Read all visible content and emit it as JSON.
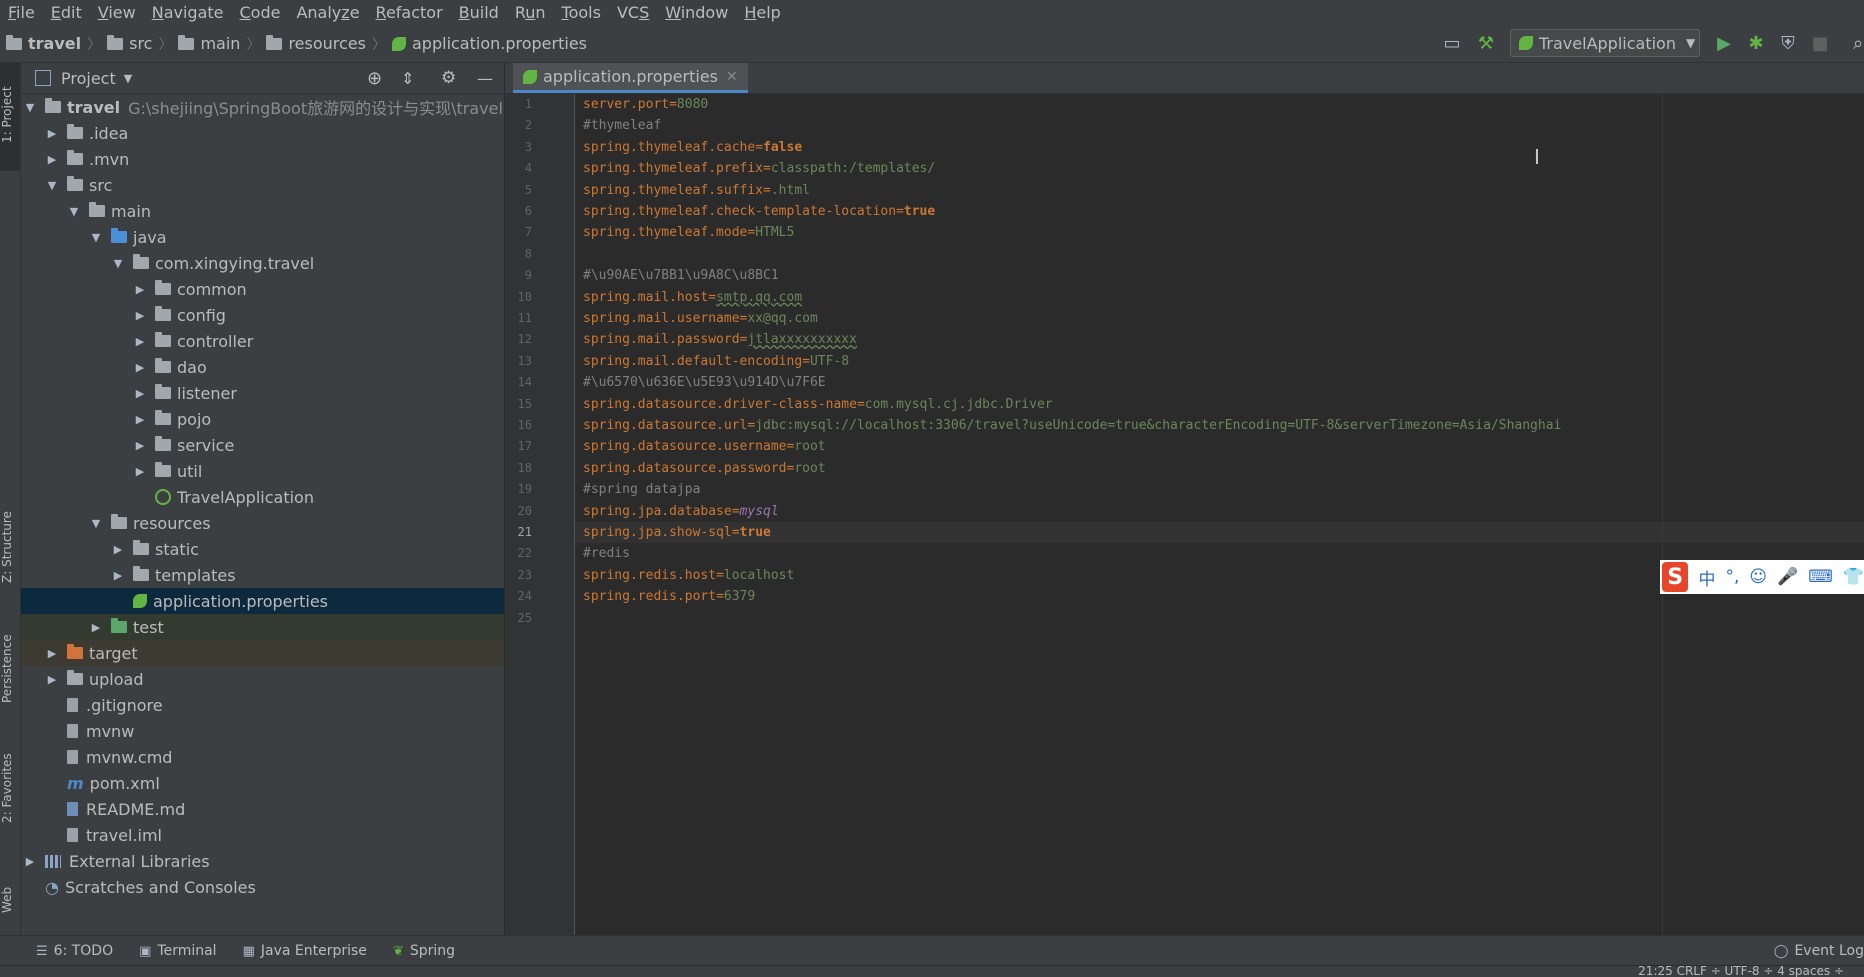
{
  "menu": [
    {
      "label": "File",
      "mn": "F"
    },
    {
      "label": "Edit",
      "mn": "E"
    },
    {
      "label": "View",
      "mn": "V"
    },
    {
      "label": "Navigate",
      "mn": "N"
    },
    {
      "label": "Code",
      "mn": "C"
    },
    {
      "label": "Analyze",
      "mn": "z"
    },
    {
      "label": "Refactor",
      "mn": "R"
    },
    {
      "label": "Build",
      "mn": "B"
    },
    {
      "label": "Run",
      "mn": "u"
    },
    {
      "label": "Tools",
      "mn": "T"
    },
    {
      "label": "VCS",
      "mn": "S"
    },
    {
      "label": "Window",
      "mn": "W"
    },
    {
      "label": "Help",
      "mn": "H"
    }
  ],
  "breadcrumb": {
    "project": "travel",
    "src": "src",
    "main": "main",
    "resources": "resources",
    "file": "application.properties"
  },
  "run_config": {
    "label": "TravelApplication"
  },
  "left_tabs": {
    "project": "1: Project",
    "structure": "Z: Structure",
    "persistence": "Persistence",
    "favorites": "2: Favorites",
    "web": "Web"
  },
  "project_panel": {
    "title": "Project"
  },
  "tree": {
    "root": "travel",
    "root_path": "G:\\shejiing\\SpringBoot旅游网的设计与实现\\travel",
    "idea": ".idea",
    "mvn": ".mvn",
    "src": "src",
    "main": "main",
    "java": "java",
    "pkg": "com.xingying.travel",
    "common": "common",
    "config": "config",
    "controller": "controller",
    "dao": "dao",
    "listener": "listener",
    "pojo": "pojo",
    "service": "service",
    "util": "util",
    "app": "TravelApplication",
    "resources": "resources",
    "static": "static",
    "templates": "templates",
    "props": "application.properties",
    "test": "test",
    "target": "target",
    "upload": "upload",
    "gitignore": ".gitignore",
    "mvnw": "mvnw",
    "mvnw_cmd": "mvnw.cmd",
    "pom": "pom.xml",
    "readme": "README.md",
    "iml": "travel.iml",
    "ext": "External Libraries",
    "scratch": "Scratches and Consoles"
  },
  "editor": {
    "tab": "application.properties",
    "lines": [
      {
        "k": "server.port",
        "v": "8080"
      },
      {
        "c": "#thymeleaf"
      },
      {
        "k": "spring.thymeleaf.cache",
        "v": "false",
        "kw": true
      },
      {
        "k": "spring.thymeleaf.prefix",
        "v": "classpath:/templates/"
      },
      {
        "k": "spring.thymeleaf.suffix",
        "v": ".html"
      },
      {
        "k": "spring.thymeleaf.check-template-location",
        "v": "true",
        "kw": true
      },
      {
        "k": "spring.thymeleaf.mode",
        "v": "HTML5"
      },
      {
        "e": true
      },
      {
        "c": "#\\u90AE\\u7BB1\\u9A8C\\u8BC1"
      },
      {
        "k": "spring.mail.host",
        "v": "smtp.qq.com"
      },
      {
        "k": "spring.mail.username",
        "v": "xx@qq.com"
      },
      {
        "k": "spring.mail.password",
        "v": "jtlaxxxxxxxxxx"
      },
      {
        "k": "spring.mail.default-encoding",
        "v": "UTF-8"
      },
      {
        "c": "#\\u6570\\u636E\\u5E93\\u914D\\u7F6E"
      },
      {
        "k": "spring.datasource.driver-class-name",
        "v": "com.mysql.cj.jdbc.Driver"
      },
      {
        "k": "spring.datasource.url",
        "v": "jdbc:mysql://localhost:3306/travel?useUnicode=true&characterEncoding=UTF-8&serverTimezone=Asia/Shanghai"
      },
      {
        "k": "spring.datasource.username",
        "v": "root"
      },
      {
        "k": "spring.datasource.password",
        "v": "root"
      },
      {
        "c": "#spring datajpa"
      },
      {
        "k": "spring.jpa.database",
        "v": "mysql",
        "it": true
      },
      {
        "k": "spring.jpa.show-sql",
        "v": "true",
        "kw": true
      },
      {
        "c": "#redis"
      },
      {
        "k": "spring.redis.host",
        "v": "localhost"
      },
      {
        "k": "spring.redis.port",
        "v": "6379"
      },
      {
        "e": true
      }
    ],
    "current_line": 21
  },
  "ime": {
    "logo": "S",
    "glyphs": [
      "中",
      "°,",
      "☺",
      "🎤",
      "⌨",
      "👕"
    ]
  },
  "bottom_tabs": {
    "todo": "6: TODO",
    "terminal": "Terminal",
    "java_ent": "Java Enterprise",
    "spring": "Spring",
    "event_log": "Event Log"
  },
  "status": {
    "text": "21:25   CRLF ÷   UTF-8 ÷   4 spaces ÷"
  },
  "colors": {
    "key": "#cc7832",
    "value": "#6a8759",
    "comment": "#808080"
  }
}
